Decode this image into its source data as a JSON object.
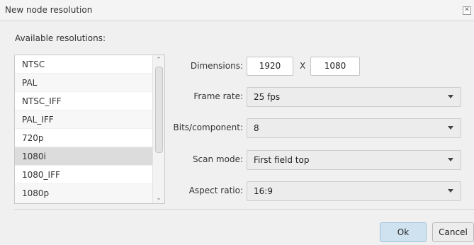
{
  "window": {
    "title": "New node resolution"
  },
  "resolutions": {
    "label": "Available resolutions:",
    "items": [
      "NTSC",
      "PAL",
      "NTSC_IFF",
      "PAL_IFF",
      "720p",
      "1080i",
      "1080_IFF",
      "1080p"
    ],
    "selected": "1080i"
  },
  "form": {
    "dimensions_label": "Dimensions:",
    "width": "1920",
    "x_separator": "X",
    "height": "1080",
    "frame_rate_label": "Frame rate:",
    "frame_rate": "25 fps",
    "bits_label": "Bits/component:",
    "bits": "8",
    "scan_mode_label": "Scan mode:",
    "scan_mode": "First field top",
    "aspect_label": "Aspect ratio:",
    "aspect": "16:9"
  },
  "buttons": {
    "ok": "Ok",
    "cancel": "Cancel"
  }
}
